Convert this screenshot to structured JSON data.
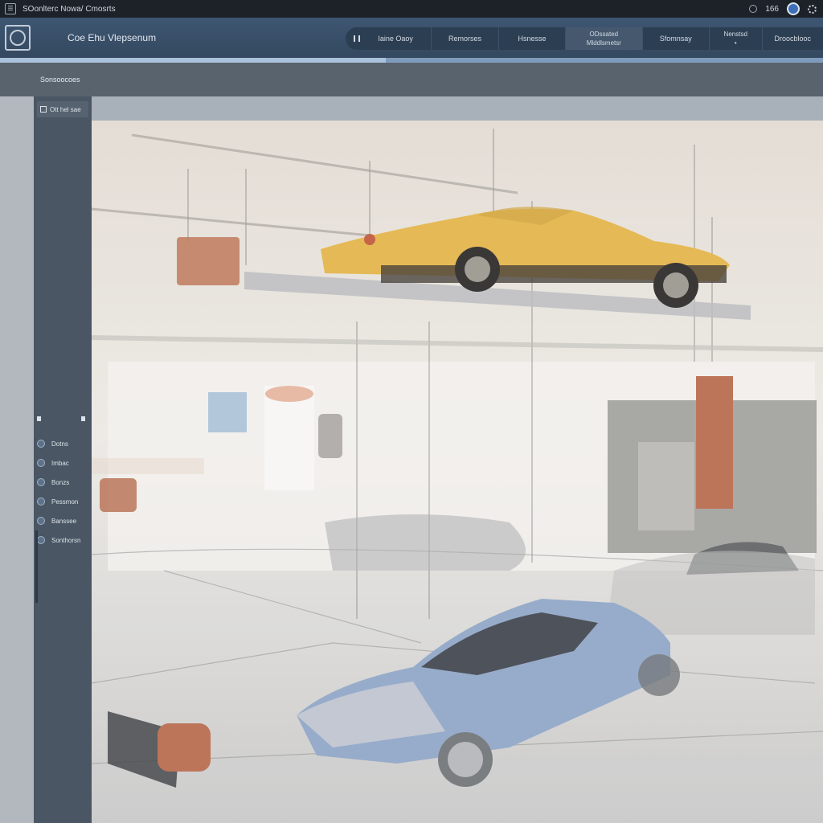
{
  "os_bar": {
    "title": "SOonlterc Nowa/ Cmosrts",
    "status_text": "166"
  },
  "header": {
    "app_title": "Coe Ehu Vlepsenum",
    "nav": [
      {
        "label": "Iaine Oaoy"
      },
      {
        "label": "Remorses"
      },
      {
        "label": "Hsnesse"
      },
      {
        "label_line1": "ODssated",
        "label_line2": "Mlddlsmetsr"
      },
      {
        "label": "Sfomnsay"
      },
      {
        "label_line1": "Nenstsd",
        "label_line2": "•"
      },
      {
        "label": "Droocblooc"
      }
    ]
  },
  "sub_bar": {
    "breadcrumb": "Sonsoocoes"
  },
  "sidebar": {
    "header_label": "Ott hel sae",
    "items": [
      {
        "label": "Dotns"
      },
      {
        "label": "Imbac"
      },
      {
        "label": "Bonzs"
      },
      {
        "label": "Pessmon"
      },
      {
        "label": "Banssee"
      },
      {
        "label": "Sonthorsn"
      }
    ]
  },
  "colors": {
    "header": "#3e5673",
    "sidebar": "#4a5663",
    "yellow_car": "#e3b447",
    "blue_car": "#8fa5c6",
    "accent_panel": "#b86a4d"
  }
}
